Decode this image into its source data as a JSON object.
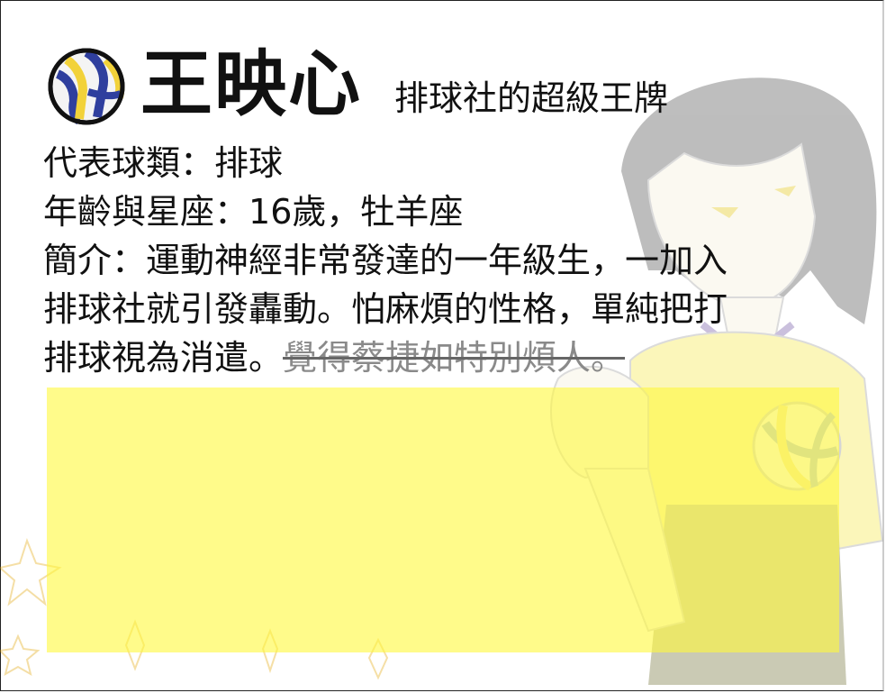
{
  "header": {
    "name": "王映心",
    "subtitle": "排球社的超級王牌"
  },
  "info": {
    "ball_label": "代表球類：",
    "ball_value": "排球",
    "age_label": "年齡與星座：",
    "age_value": "16歲，牡羊座",
    "intro_label": "簡介：",
    "intro_line1": "運動神經非常發達的一年級生，一加入",
    "intro_line2": "排球社就引發轟動。怕麻煩的性格，單純把打",
    "intro_line3": "排球視為消遣。",
    "intro_struck": "覺得蔡捷如特別煩人。"
  },
  "colors": {
    "highlight_box": "#fff83c",
    "ball_blue": "#2f3f9e",
    "ball_yellow": "#f2d23a"
  },
  "icons": {
    "header_icon": "volleyball-icon",
    "background": "volleyball-girl-illustration"
  }
}
